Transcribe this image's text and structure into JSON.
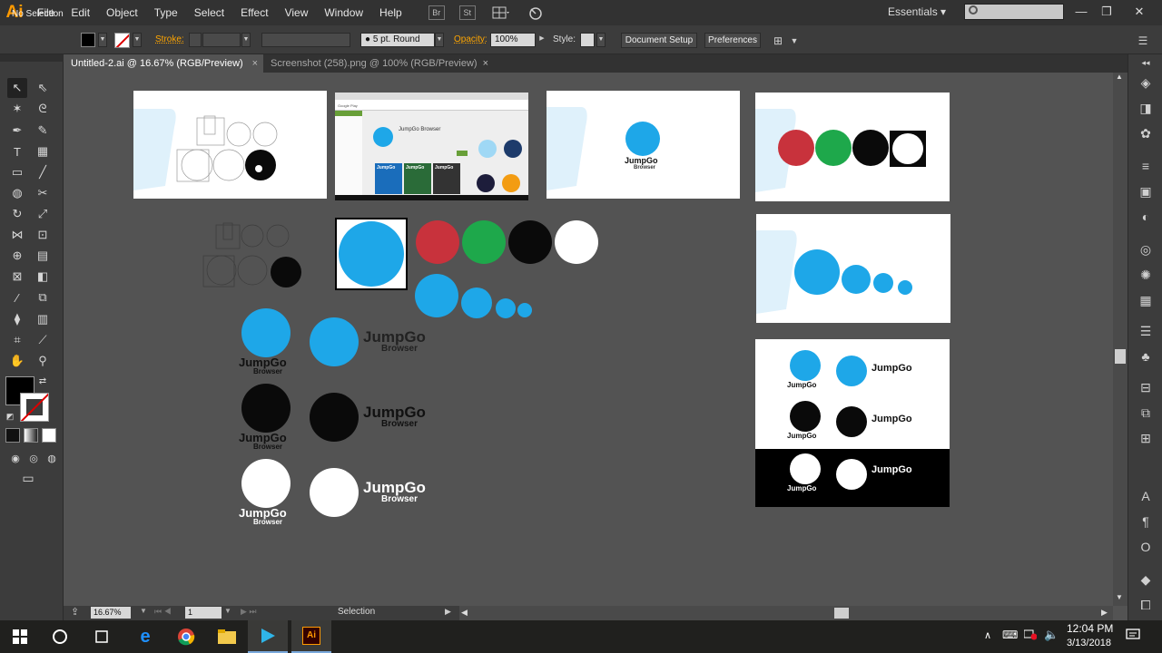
{
  "app": {
    "logo": "Ai"
  },
  "menu": [
    "File",
    "Edit",
    "Object",
    "Type",
    "Select",
    "Effect",
    "View",
    "Window",
    "Help"
  ],
  "menu_icons": {
    "br": "Br",
    "st": "St"
  },
  "workspace": "Essentials",
  "control": {
    "selection": "No Selection",
    "stroke_label": "Stroke:",
    "brush": "5 pt. Round",
    "opacity_label": "Opacity:",
    "opacity_value": "100%",
    "style_label": "Style:",
    "document_setup": "Document Setup",
    "preferences": "Preferences"
  },
  "tabs": [
    {
      "label": "Untitled-2.ai @ 16.67% (RGB/Preview)",
      "close": "×"
    },
    {
      "label": "Screenshot (258).png @ 100% (RGB/Preview)",
      "close": "×"
    }
  ],
  "status": {
    "zoom": "16.67%",
    "page": "1",
    "tool": "Selection"
  },
  "artwork": {
    "brand_name": "JumpGo",
    "brand_sub": "Browser",
    "store_title": "JumpGo Browser",
    "store_tag": "Google Play",
    "screenshot_captions": [
      "JumpGo",
      "JumpGo",
      "JumpGo"
    ]
  },
  "colors": {
    "blue": "#1ea7e8",
    "red": "#c8323c",
    "green": "#1ea84b",
    "black": "#0a0a0a",
    "accent": "#ffa600"
  },
  "taskbar": {
    "time": "12:04 PM",
    "date": "3/13/2018"
  }
}
